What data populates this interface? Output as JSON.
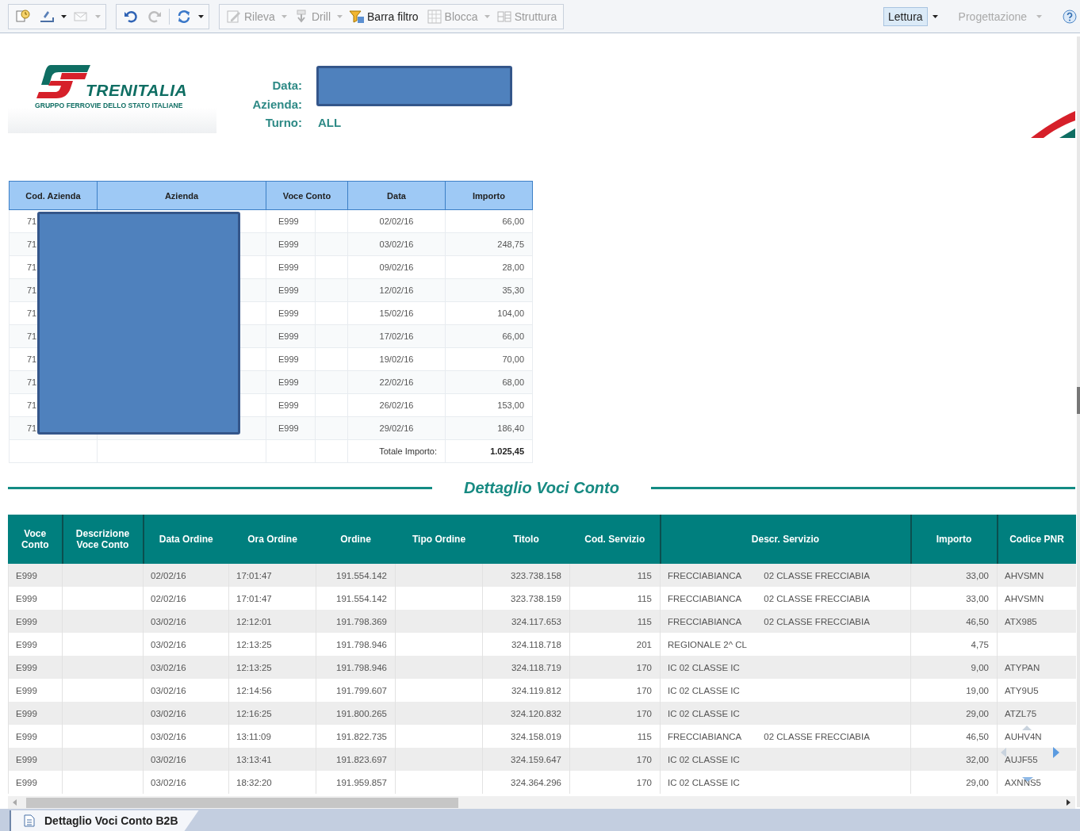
{
  "toolbar": {
    "groups": [
      {
        "items": [
          {
            "disabled": false,
            "caret": false
          },
          {
            "disabled": false,
            "caret": true
          },
          {
            "disabled": true,
            "caret": true
          }
        ]
      },
      {
        "items": [
          {
            "disabled": false,
            "caret": false
          },
          {
            "disabled": true,
            "caret": false
          },
          {
            "disabled": false,
            "caret": true
          }
        ]
      },
      {
        "items": [
          {
            "label": "Rileva",
            "disabled": true,
            "caret": true
          },
          {
            "label": "Drill",
            "disabled": true,
            "caret": true
          },
          {
            "label": "Barra filtro",
            "disabled": false,
            "caret": false
          },
          {
            "label": "Blocca",
            "disabled": true,
            "caret": true
          },
          {
            "label": "Struttura",
            "disabled": true,
            "caret": false
          }
        ]
      }
    ],
    "modes": [
      {
        "label": "Lettura",
        "selected": true
      },
      {
        "label": "Progettazione",
        "selected": false
      }
    ]
  },
  "header": {
    "logo": {
      "name": "TRENITALIA",
      "tagline": "GRUPPO FERROVIE DELLO STATO ITALIANE"
    },
    "info_redacted": true,
    "fields": [
      {
        "label": "Data:"
      },
      {
        "label": "Azienda:"
      },
      {
        "label": "Turno:",
        "value": "ALL"
      }
    ]
  },
  "summary_table": {
    "columns": [
      "Cod. Azienda",
      "Azienda",
      "Voce Conto",
      "Data",
      "Importo"
    ],
    "azienda_redacted": true,
    "rows": [
      {
        "cod": "71",
        "voce": "E999",
        "data": "02/02/16",
        "importo": "66,00"
      },
      {
        "cod": "71",
        "voce": "E999",
        "data": "03/02/16",
        "importo": "248,75"
      },
      {
        "cod": "71",
        "voce": "E999",
        "data": "09/02/16",
        "importo": "28,00"
      },
      {
        "cod": "71",
        "voce": "E999",
        "data": "12/02/16",
        "importo": "35,30"
      },
      {
        "cod": "71",
        "voce": "E999",
        "data": "15/02/16",
        "importo": "104,00"
      },
      {
        "cod": "71",
        "voce": "E999",
        "data": "17/02/16",
        "importo": "66,00"
      },
      {
        "cod": "71",
        "voce": "E999",
        "data": "19/02/16",
        "importo": "70,00"
      },
      {
        "cod": "71",
        "voce": "E999",
        "data": "22/02/16",
        "importo": "68,00"
      },
      {
        "cod": "71",
        "voce": "E999",
        "data": "26/02/16",
        "importo": "153,00"
      },
      {
        "cod": "71",
        "voce": "E999",
        "data": "29/02/16",
        "importo": "186,40"
      }
    ],
    "total": {
      "label": "Totale Importo:",
      "value": "1.025,45"
    }
  },
  "detail": {
    "title": "Dettaglio Voci Conto",
    "columns": [
      "Voce Conto",
      "Descrizione Voce Conto",
      "Data Ordine",
      "Ora Ordine",
      "Ordine",
      "Tipo Ordine",
      "Titolo",
      "Cod. Servizio",
      "Descr. Servizio",
      "Importo",
      "Codice PNR"
    ],
    "rows": [
      {
        "voce": "E999",
        "data": "02/02/16",
        "ora": "17:01:47",
        "ordine": "191.554.142",
        "titolo": "323.738.158",
        "cod": "115",
        "servizio": "FRECCIABIANCA",
        "classe": "02 CLASSE FRECCIABIA",
        "importo": "33,00",
        "pnr": "AHVSMN"
      },
      {
        "voce": "E999",
        "data": "02/02/16",
        "ora": "17:01:47",
        "ordine": "191.554.142",
        "titolo": "323.738.159",
        "cod": "115",
        "servizio": "FRECCIABIANCA",
        "classe": "02 CLASSE FRECCIABIA",
        "importo": "33,00",
        "pnr": "AHVSMN"
      },
      {
        "voce": "E999",
        "data": "03/02/16",
        "ora": "12:12:01",
        "ordine": "191.798.369",
        "titolo": "324.117.653",
        "cod": "115",
        "servizio": "FRECCIABIANCA",
        "classe": "02 CLASSE FRECCIABIA",
        "importo": "46,50",
        "pnr": "ATX985"
      },
      {
        "voce": "E999",
        "data": "03/02/16",
        "ora": "12:13:25",
        "ordine": "191.798.946",
        "titolo": "324.118.718",
        "cod": "201",
        "servizio": "REGIONALE 2^ CL",
        "importo": "4,75"
      },
      {
        "voce": "E999",
        "data": "03/02/16",
        "ora": "12:13:25",
        "ordine": "191.798.946",
        "titolo": "324.118.719",
        "cod": "170",
        "servizio": "IC 02 CLASSE IC",
        "importo": "9,00",
        "pnr": "ATYPAN"
      },
      {
        "voce": "E999",
        "data": "03/02/16",
        "ora": "12:14:56",
        "ordine": "191.799.607",
        "titolo": "324.119.812",
        "cod": "170",
        "servizio": "IC 02 CLASSE IC",
        "importo": "19,00",
        "pnr": "ATY9U5"
      },
      {
        "voce": "E999",
        "data": "03/02/16",
        "ora": "12:16:25",
        "ordine": "191.800.265",
        "titolo": "324.120.832",
        "cod": "170",
        "servizio": "IC 02 CLASSE IC",
        "importo": "29,00",
        "pnr": "ATZL75"
      },
      {
        "voce": "E999",
        "data": "03/02/16",
        "ora": "13:11:09",
        "ordine": "191.822.735",
        "titolo": "324.158.019",
        "cod": "115",
        "servizio": "FRECCIABIANCA",
        "classe": "02 CLASSE FRECCIABIA",
        "importo": "46,50",
        "pnr": "AUHV4N"
      },
      {
        "voce": "E999",
        "data": "03/02/16",
        "ora": "13:13:41",
        "ordine": "191.823.697",
        "titolo": "324.159.647",
        "cod": "170",
        "servizio": "IC 02 CLASSE IC",
        "importo": "32,00",
        "pnr": "AUJF55"
      },
      {
        "voce": "E999",
        "data": "03/02/16",
        "ora": "18:32:20",
        "ordine": "191.959.857",
        "titolo": "324.364.296",
        "cod": "170",
        "servizio": "IC 02 CLASSE IC",
        "importo": "29,00",
        "pnr": "AXNNS5"
      }
    ]
  },
  "sheet_tabs": [
    {
      "label": "Dettaglio Voci Conto B2B",
      "selected": true
    }
  ]
}
